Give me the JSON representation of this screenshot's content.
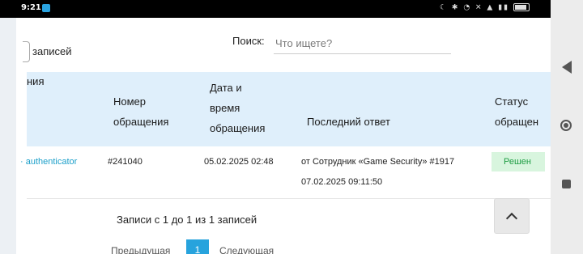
{
  "status_bar": {
    "time": "9:21",
    "icons": "☾ ✱ ◔ ✕ ▲ ▮▮",
    "battery": "97"
  },
  "length_control": {
    "label": "записей"
  },
  "search": {
    "label": "Поиск:",
    "placeholder": "Что ищете?"
  },
  "table": {
    "headers": [
      {
        "lines": [
          "",
          "",
          "ния"
        ]
      },
      {
        "lines": [
          "",
          "Номер",
          "обращения"
        ]
      },
      {
        "lines": [
          "Дата и",
          "время",
          "обращения"
        ]
      },
      {
        "lines": [
          "",
          "",
          "Последний ответ"
        ]
      },
      {
        "lines": [
          "",
          "Статус",
          "обращен"
        ]
      }
    ],
    "rows": [
      {
        "subject": "authenticator",
        "number": "#241040",
        "date": "05.02.2025 02:48",
        "last_reply_line1": "от Сотрудник «Game Security» #1917",
        "last_reply_line2": "07.02.2025 09:11:50",
        "status": "Решен"
      }
    ]
  },
  "pagination": {
    "info": "Записи с 1 до 1 из 1 записей",
    "prev": "Предыдущая",
    "current_page": "1",
    "next": "Следующая"
  },
  "colors": {
    "header_bg": "#dfeffb",
    "link": "#1b9fc9",
    "status_bg": "#d8f5de",
    "status_text": "#1f9d44",
    "page_active": "#27a3dd"
  }
}
